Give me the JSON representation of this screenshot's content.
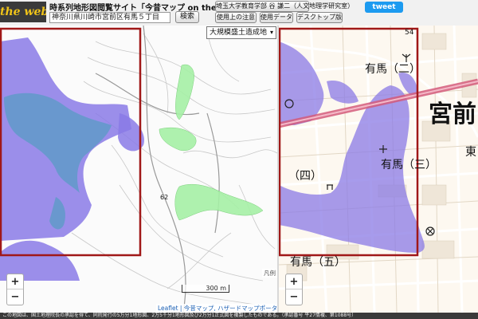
{
  "header": {
    "logo": "the web",
    "site_title": "時系列地形図閲覧サイト「今昔マップ on the web」",
    "address": "神奈川県川崎市宮前区有馬５丁目",
    "search_label": "検索",
    "author_label": "埼玉大学教育学部 谷 謙二（人文地理学研究室）",
    "notes_label": "使用上の注意",
    "data_label": "使用データ",
    "desktop_label": "デスクトップ版",
    "tweet_label": "tweet"
  },
  "left_map": {
    "layer_select": "大規模盛土造成地",
    "zoom_in": "+",
    "zoom_out": "−",
    "scale_label": "300 m",
    "elevation_label": "62",
    "attribution": "Leaflet | 今昔マップ, ハザードマップポータルサイト",
    "small_label": "凡例"
  },
  "right_map": {
    "zoom_in": "+",
    "zoom_out": "−",
    "labels": {
      "arima2": "有馬（二）",
      "miyamae": "宮前",
      "higashi": "東",
      "arima4": "（四）",
      "arima3": "有馬（三）",
      "arima5": "有馬（五）",
      "grid_num": "54"
    }
  },
  "footer": {
    "text": "この地図は、国土地理院長の承認を得て、同院発行の5万分1地形図、2万5千分1地形図及び2万分1正式図を複製したものである。（承認番号 平27情複、第1088号）"
  },
  "colors": {
    "fill_purple": "#8a7ae6",
    "fill_blue": "#5d9bc7",
    "fill_green": "#a5f0a5",
    "frame_red": "#a01818",
    "road_pink": "#d45a7a"
  }
}
